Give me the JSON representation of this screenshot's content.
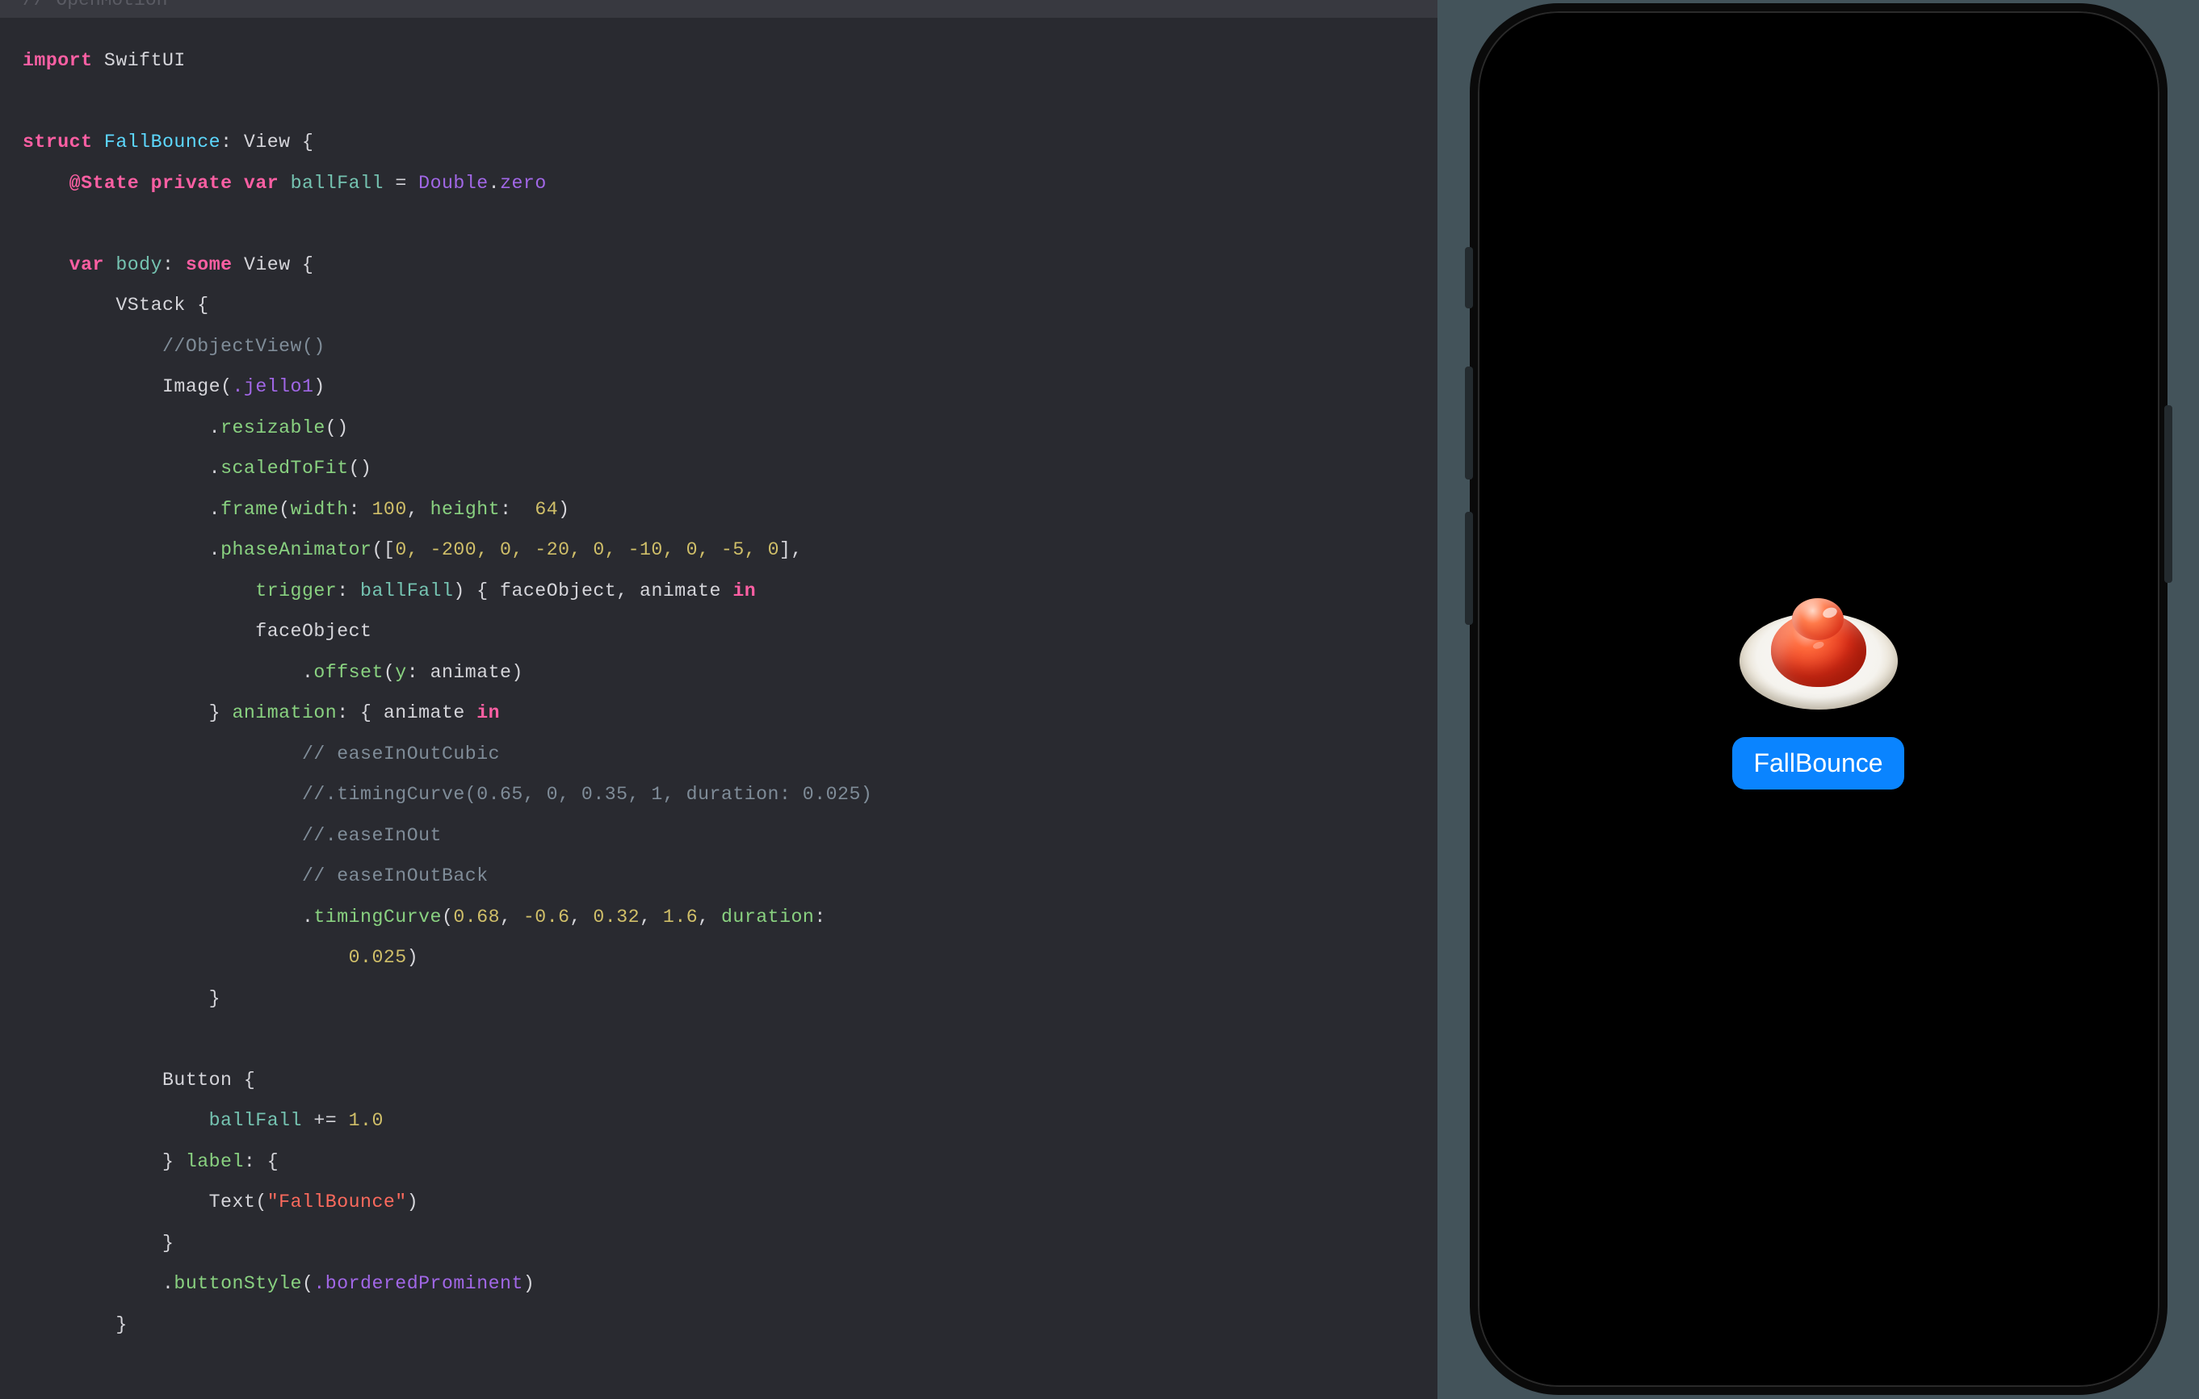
{
  "topbar": {
    "comment": "//  OpenMotion"
  },
  "code": {
    "import_kw": "import",
    "swiftui": "SwiftUI",
    "struct_kw": "struct",
    "struct_name": "FallBounce",
    "view_proto": "View",
    "state_ann": "@State",
    "private_kw": "private",
    "var_kw": "var",
    "state_var": "ballFall",
    "eq": " = ",
    "double_type": "Double",
    "zero": "zero",
    "body_var": "body",
    "some_kw": "some",
    "vstack": "VStack",
    "cmt_objectview": "//ObjectView()",
    "image_call": "Image",
    "jello_asset": ".jello1",
    "resizable": "resizable",
    "scaledToFit": "scaledToFit",
    "frame": "frame",
    "width_lbl": "width",
    "width_val": "100",
    "height_lbl": "height",
    "height_val": "64",
    "phaseAnimator": "phaseAnimator",
    "phase_seq": "0, -200, 0, -20, 0, -10, 0, -5, 0",
    "trigger_lbl": "trigger",
    "trigger_var": "ballFall",
    "closure_p1": "faceObject",
    "closure_p2": "animate",
    "in_kw": "in",
    "faceObject2": "faceObject",
    "offset": "offset",
    "y_lbl": "y",
    "animate_arg": "animate",
    "animation_lbl": "animation",
    "animate_p": "animate",
    "cmt_ease1": "// easeInOutCubic",
    "cmt_timing1": "//.timingCurve(0.65, 0, 0.35, 1, duration: 0.025)",
    "cmt_easeio": "//.easeInOut",
    "cmt_easeback": "// easeInOutBack",
    "timingCurve": "timingCurve",
    "tc_v1": "0.68",
    "tc_v2": "-0.6",
    "tc_v3": "0.32",
    "tc_v4": "1.6",
    "duration_lbl": "duration",
    "duration_val": "0.025",
    "button_call": "Button",
    "ballFall_inc": "ballFall",
    "inc_op": " += ",
    "inc_val": "1.0",
    "label_lbl": "label",
    "text_call": "Text",
    "text_str": "\"FallBounce\"",
    "buttonStyle": "buttonStyle",
    "borderedProminent": ".borderedProminent"
  },
  "preview": {
    "button_label": "FallBounce"
  }
}
